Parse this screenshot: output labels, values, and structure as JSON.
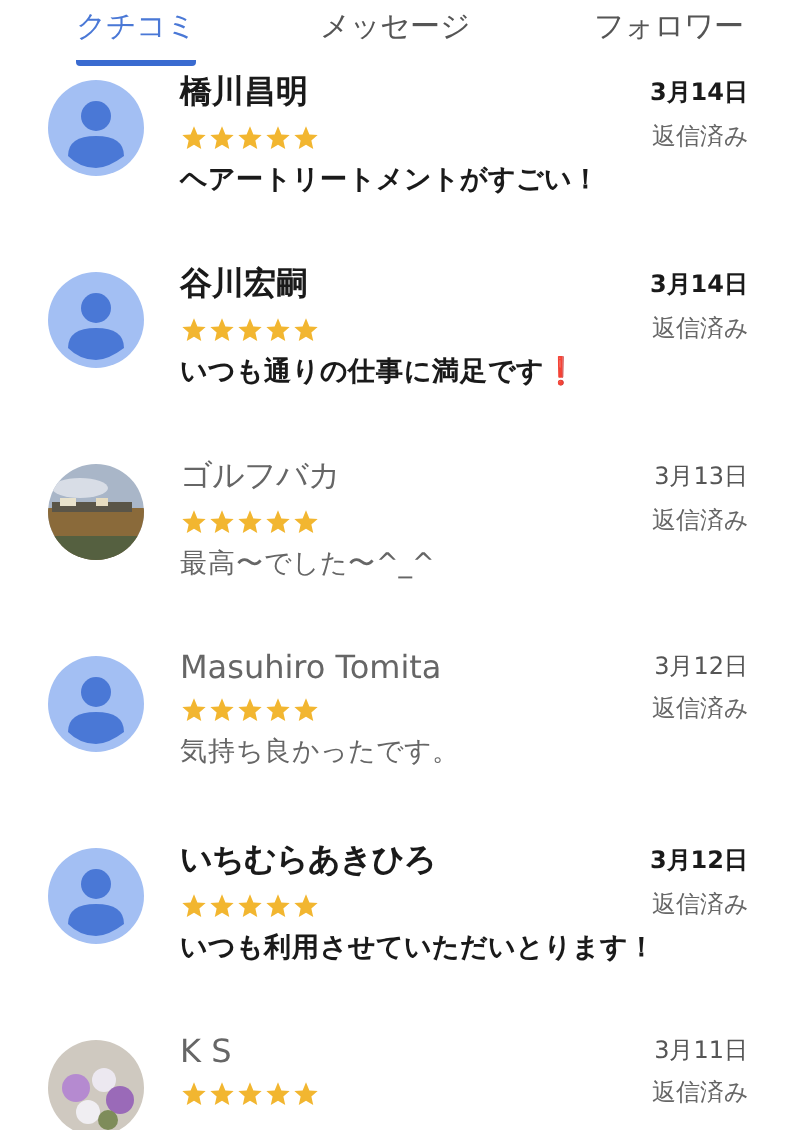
{
  "tabs": [
    {
      "label": "クチコミ",
      "selected": true
    },
    {
      "label": "メッセージ",
      "selected": false
    },
    {
      "label": "フォロワー",
      "selected": false
    }
  ],
  "reviews": [
    {
      "name": "橋川昌明",
      "kind": "default",
      "stars": 5,
      "date": "3月14日",
      "status": "返信済み",
      "comment": "ヘアートリートメントがすごい！",
      "unread": true
    },
    {
      "name": "谷川宏嗣",
      "kind": "default",
      "stars": 5,
      "date": "3月14日",
      "status": "返信済み",
      "comment": "いつも通りの仕事に満足です❗",
      "unread": true
    },
    {
      "name": "ゴルフバカ",
      "kind": "picture",
      "stars": 5,
      "date": "3月13日",
      "status": "返信済み",
      "comment": "最高〜でした〜^_^",
      "unread": false
    },
    {
      "name": "Masuhiro Tomita",
      "kind": "default",
      "stars": 5,
      "date": "3月12日",
      "status": "返信済み",
      "comment": "気持ち良かったです。",
      "unread": false
    },
    {
      "name": "いちむらあきひろ",
      "kind": "default",
      "stars": 5,
      "date": "3月12日",
      "status": "返信済み",
      "comment": "いつも利用させていただいとります！",
      "unread": true
    },
    {
      "name": "K S",
      "kind": "picture",
      "stars": 5,
      "date": "3月11日",
      "status": "返信済み",
      "unread": false
    }
  ]
}
